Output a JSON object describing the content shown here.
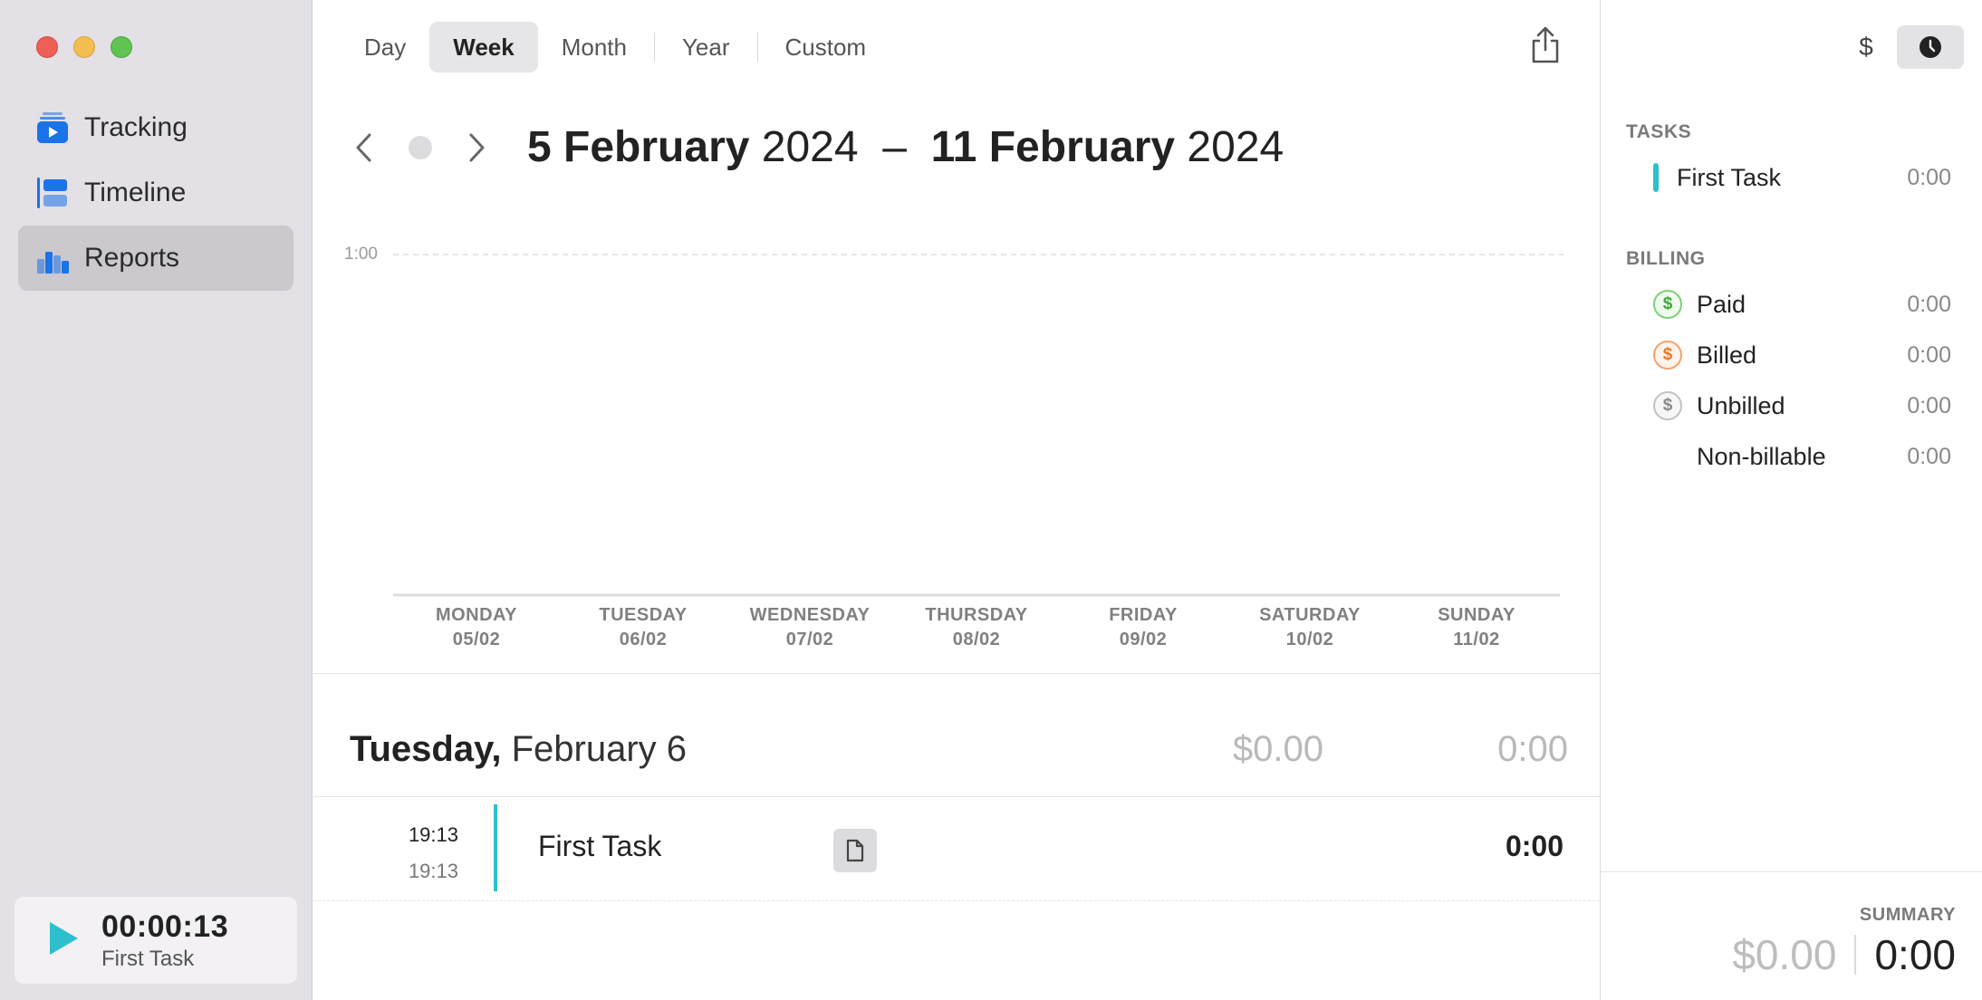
{
  "sidebar": {
    "items": [
      {
        "label": "Tracking",
        "icon": "tracking-icon"
      },
      {
        "label": "Timeline",
        "icon": "timeline-icon"
      },
      {
        "label": "Reports",
        "icon": "reports-icon",
        "active": true
      }
    ],
    "timer": {
      "time": "00:00:13",
      "task": "First Task"
    }
  },
  "toolbar": {
    "periods": [
      "Day",
      "Week",
      "Month",
      "Year",
      "Custom"
    ],
    "active_period": "Week"
  },
  "range": {
    "start_bold": "5 February",
    "start_year": " 2024",
    "separator": "  –  ",
    "end_bold": "11 February",
    "end_year": " 2024"
  },
  "chart_data": {
    "type": "bar",
    "categories": [
      "MONDAY 05/02",
      "TUESDAY 06/02",
      "WEDNESDAY 07/02",
      "THURSDAY 08/02",
      "FRIDAY 09/02",
      "SATURDAY 10/02",
      "SUNDAY 11/02"
    ],
    "day_names": [
      "MONDAY",
      "TUESDAY",
      "WEDNESDAY",
      "THURSDAY",
      "FRIDAY",
      "SATURDAY",
      "SUNDAY"
    ],
    "day_dates": [
      "05/02",
      "06/02",
      "07/02",
      "08/02",
      "09/02",
      "10/02",
      "11/02"
    ],
    "values": [
      0,
      0,
      0,
      0,
      0,
      0,
      0
    ],
    "y_tick": "1:00",
    "grid": true
  },
  "day_group": {
    "name": "Tuesday,",
    "date": " February 6",
    "amount": "$0.00",
    "duration": "0:00",
    "entries": [
      {
        "start": "19:13",
        "end": "19:13",
        "task": "First Task",
        "duration": "0:00"
      }
    ]
  },
  "right_panel": {
    "toggle_dollar": "$",
    "tasks_label": "TASKS",
    "tasks": [
      {
        "name": "First Task",
        "value": "0:00",
        "color": "#2dc0cc"
      }
    ],
    "billing_label": "BILLING",
    "billing": [
      {
        "name": "Paid",
        "value": "0:00"
      },
      {
        "name": "Billed",
        "value": "0:00"
      },
      {
        "name": "Unbilled",
        "value": "0:00"
      },
      {
        "name": "Non-billable",
        "value": "0:00"
      }
    ],
    "summary_label": "SUMMARY",
    "summary_amount": "$0.00",
    "summary_duration": "0:00"
  },
  "colors": {
    "accent": "#2dc0cc",
    "blue": "#1a73e8",
    "paid": "#3aaa35",
    "billed": "#e8782e"
  }
}
